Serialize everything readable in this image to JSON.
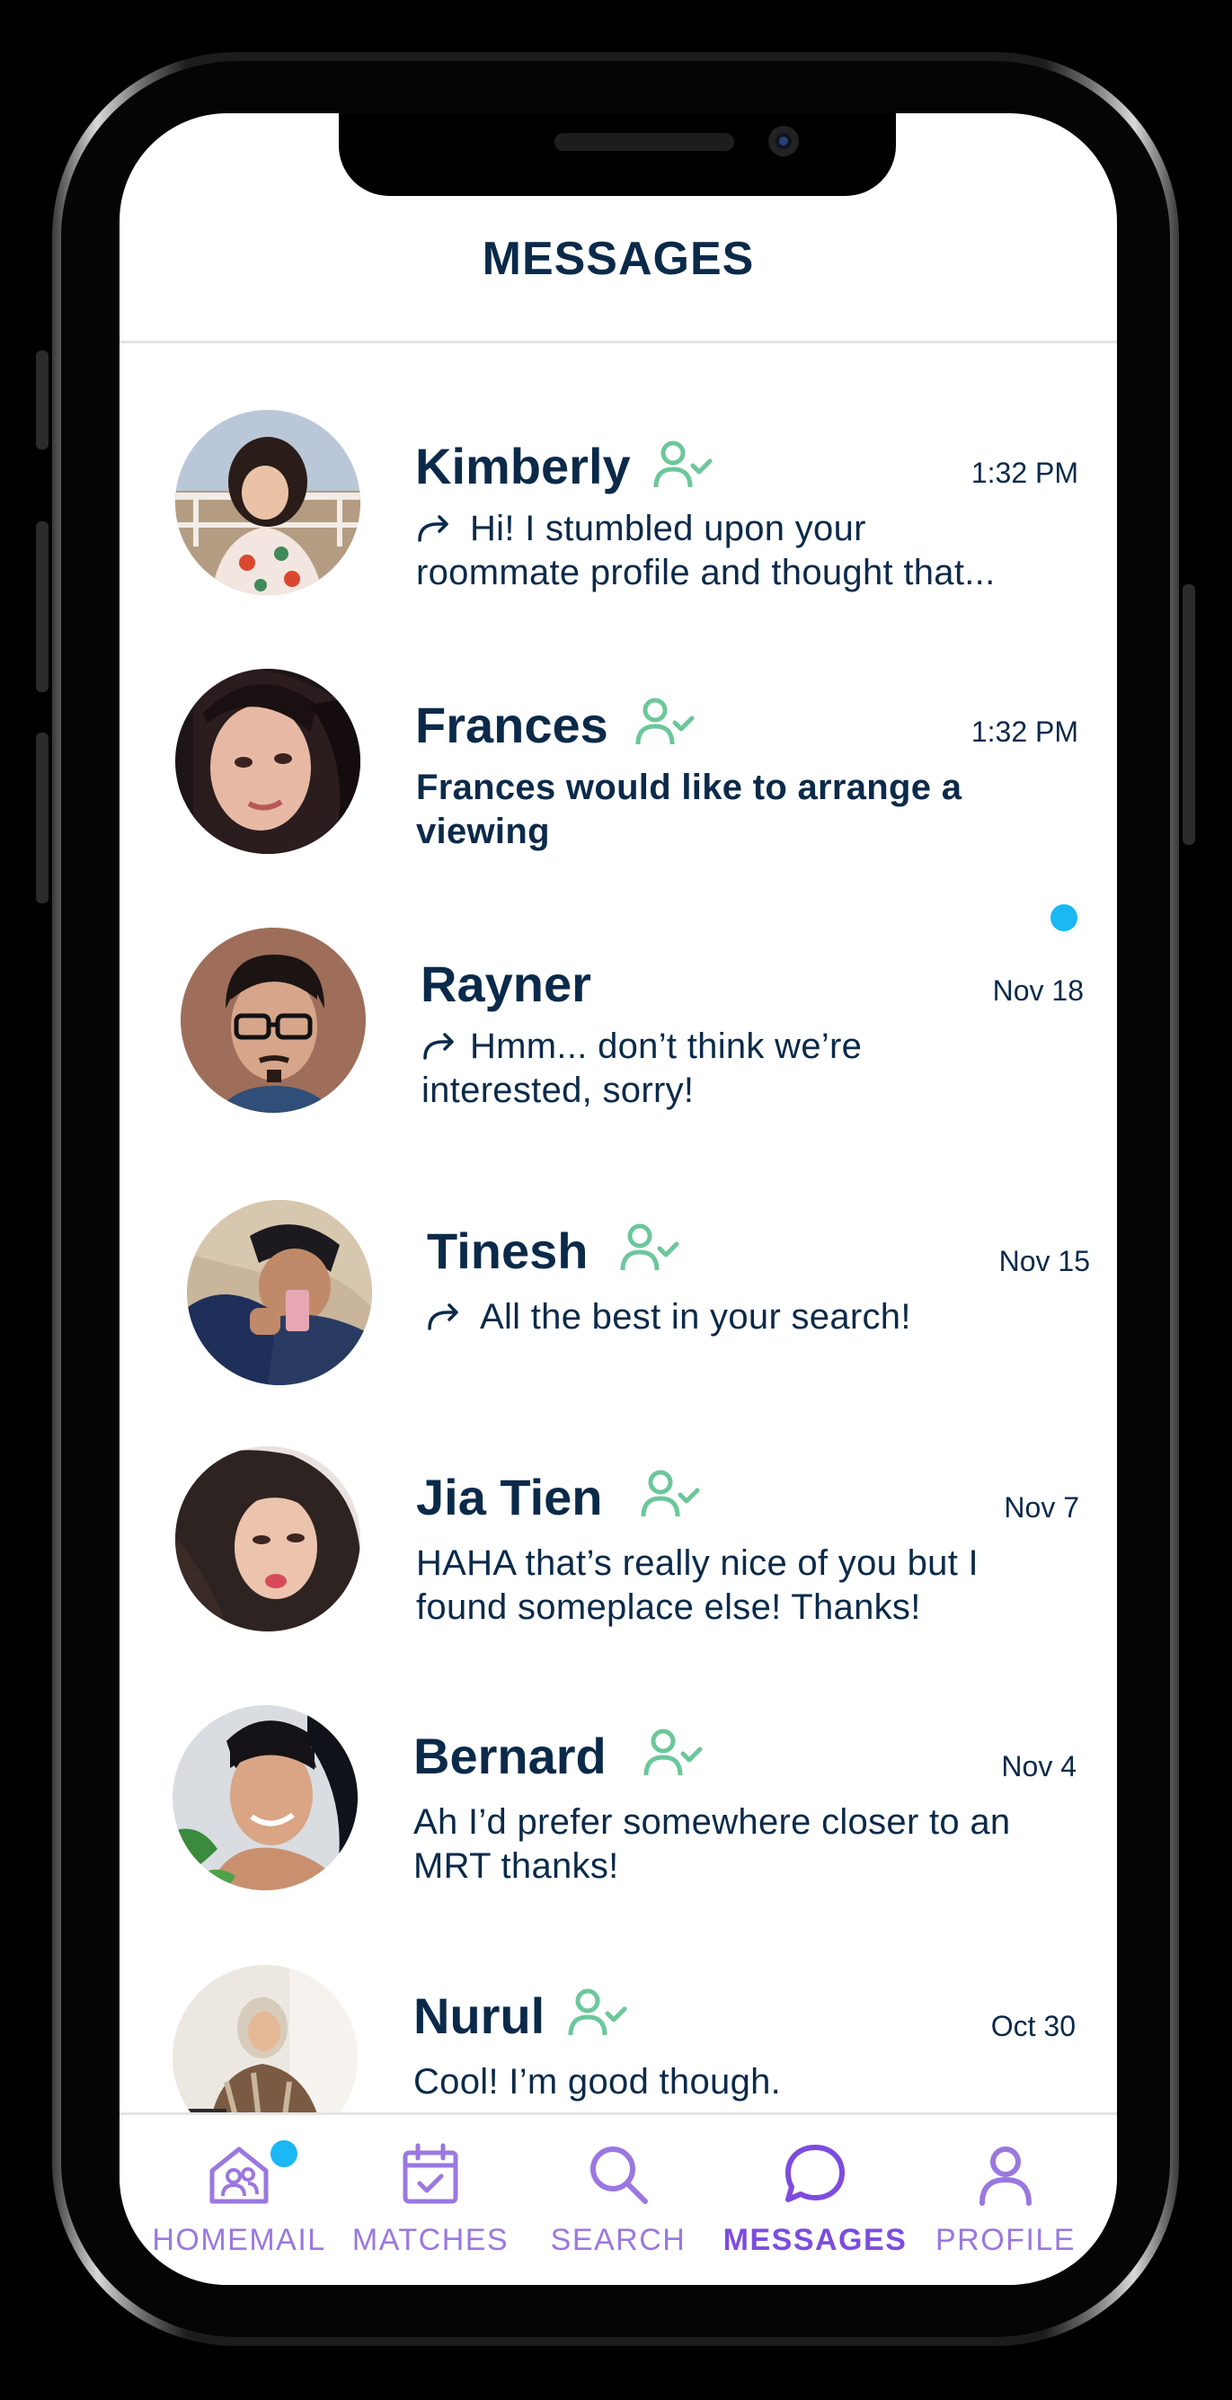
{
  "header": {
    "title": "MESSAGES"
  },
  "colors": {
    "navy": "#0b2a4a",
    "accent_purple": "#7d4cde",
    "friend_green": "#6cc79a",
    "unread_blue": "#1ab8f4"
  },
  "conversations": [
    {
      "name": "Kimberly",
      "time": "1:32 PM",
      "preview": "Hi! I stumbled upon your roommate profile and thought that...",
      "forwarded": true,
      "friend_icon": true,
      "unread": false
    },
    {
      "name": "Frances",
      "time": "1:32 PM",
      "preview": "Frances would like to arrange a viewing",
      "forwarded": false,
      "friend_icon": true,
      "unread": true
    },
    {
      "name": "Rayner",
      "time": "Nov 18",
      "preview": "Hmm... don’t think we’re interested, sorry!",
      "forwarded": true,
      "friend_icon": false,
      "unread": false
    },
    {
      "name": "Tinesh",
      "time": "Nov 15",
      "preview": "All the best in your search!",
      "forwarded": true,
      "friend_icon": true,
      "unread": false
    },
    {
      "name": "Jia Tien",
      "time": "Nov 7",
      "preview": "HAHA that’s really nice of you but I found someplace else! Thanks!",
      "forwarded": false,
      "friend_icon": true,
      "unread": false
    },
    {
      "name": "Bernard",
      "time": "Nov 4",
      "preview": "Ah I’d prefer somewhere closer to an MRT thanks!",
      "forwarded": false,
      "friend_icon": true,
      "unread": false
    },
    {
      "name": "Nurul",
      "time": "Oct 30",
      "preview": "Cool! I’m good though.",
      "forwarded": false,
      "friend_icon": true,
      "unread": false
    }
  ],
  "nav": {
    "items": [
      {
        "label": "HOMEMAIL",
        "icon": "home-people-icon",
        "active": false,
        "badge": true
      },
      {
        "label": "MATCHES",
        "icon": "calendar-check-icon",
        "active": false,
        "badge": false
      },
      {
        "label": "SEARCH",
        "icon": "search-icon",
        "active": false,
        "badge": false
      },
      {
        "label": "MESSAGES",
        "icon": "chat-bubble-icon",
        "active": true,
        "badge": false
      },
      {
        "label": "PROFILE",
        "icon": "person-icon",
        "active": false,
        "badge": false
      }
    ]
  }
}
